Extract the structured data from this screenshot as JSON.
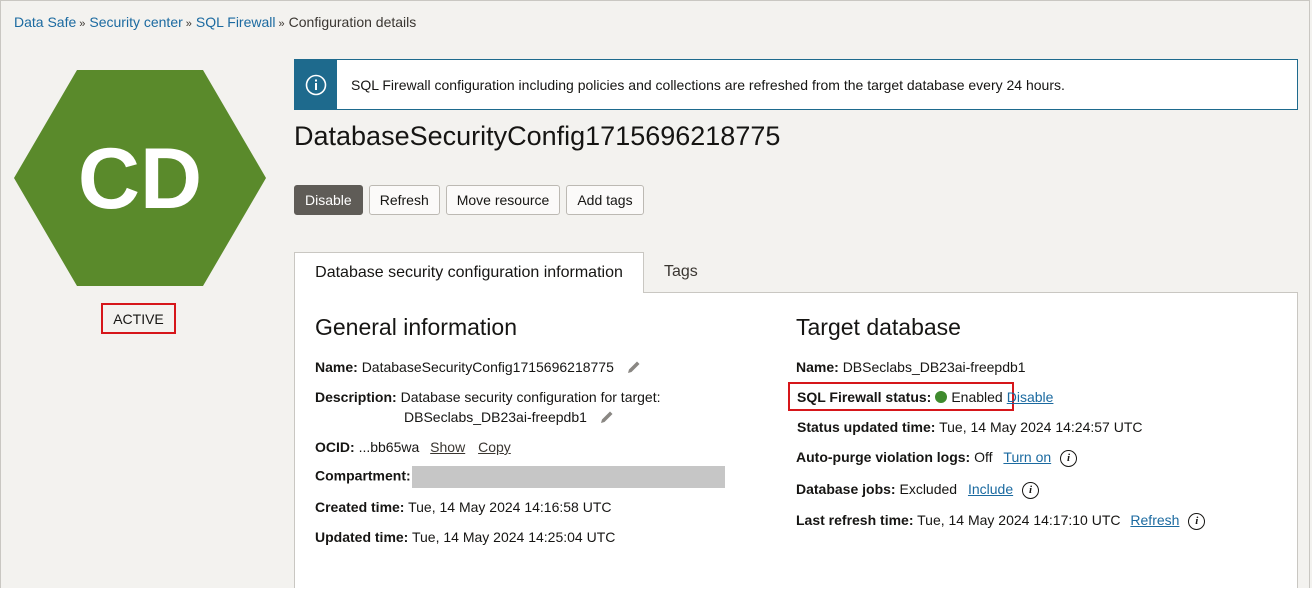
{
  "breadcrumb": {
    "items": [
      "Data Safe",
      "Security center",
      "SQL Firewall"
    ],
    "current": "Configuration details",
    "separator": "»"
  },
  "badge": {
    "initials": "CD",
    "status": "ACTIVE",
    "color": "#5a8a2b"
  },
  "banner": {
    "icon": "info-icon",
    "text": "SQL Firewall configuration including policies and collections are refreshed from the target database every 24 hours."
  },
  "title": "DatabaseSecurityConfig1715696218775",
  "actions": {
    "disable": "Disable",
    "refresh": "Refresh",
    "move": "Move resource",
    "tags": "Add tags"
  },
  "tabs": {
    "active": "Database security configuration information",
    "other": "Tags"
  },
  "general": {
    "heading": "General information",
    "name_label": "Name:",
    "name_value": "DatabaseSecurityConfig1715696218775",
    "desc_label": "Description:",
    "desc_line1": "Database security configuration for target:",
    "desc_line2": "DBSeclabs_DB23ai-freepdb1",
    "ocid_label": "OCID:",
    "ocid_value": "...bb65wa",
    "ocid_show": "Show",
    "ocid_copy": "Copy",
    "compartment_label": "Compartment:",
    "created_label": "Created time:",
    "created_value": "Tue, 14 May 2024 14:16:58 UTC",
    "updated_label": "Updated time:",
    "updated_value": "Tue, 14 May 2024 14:25:04 UTC"
  },
  "target": {
    "heading": "Target database",
    "name_label": "Name:",
    "name_value": "DBSeclabs_DB23ai-freepdb1",
    "fw_label": "SQL Firewall status:",
    "fw_value": "Enabled",
    "fw_action": "Disable",
    "status_time_label": "Status updated time:",
    "status_time_value": "Tue, 14 May 2024 14:24:57 UTC",
    "purge_label": "Auto-purge violation logs:",
    "purge_value": "Off",
    "purge_action": "Turn on",
    "jobs_label": "Database jobs:",
    "jobs_value": "Excluded",
    "jobs_action": "Include",
    "refresh_label": "Last refresh time:",
    "refresh_value": "Tue, 14 May 2024 14:17:10 UTC",
    "refresh_action": "Refresh"
  }
}
